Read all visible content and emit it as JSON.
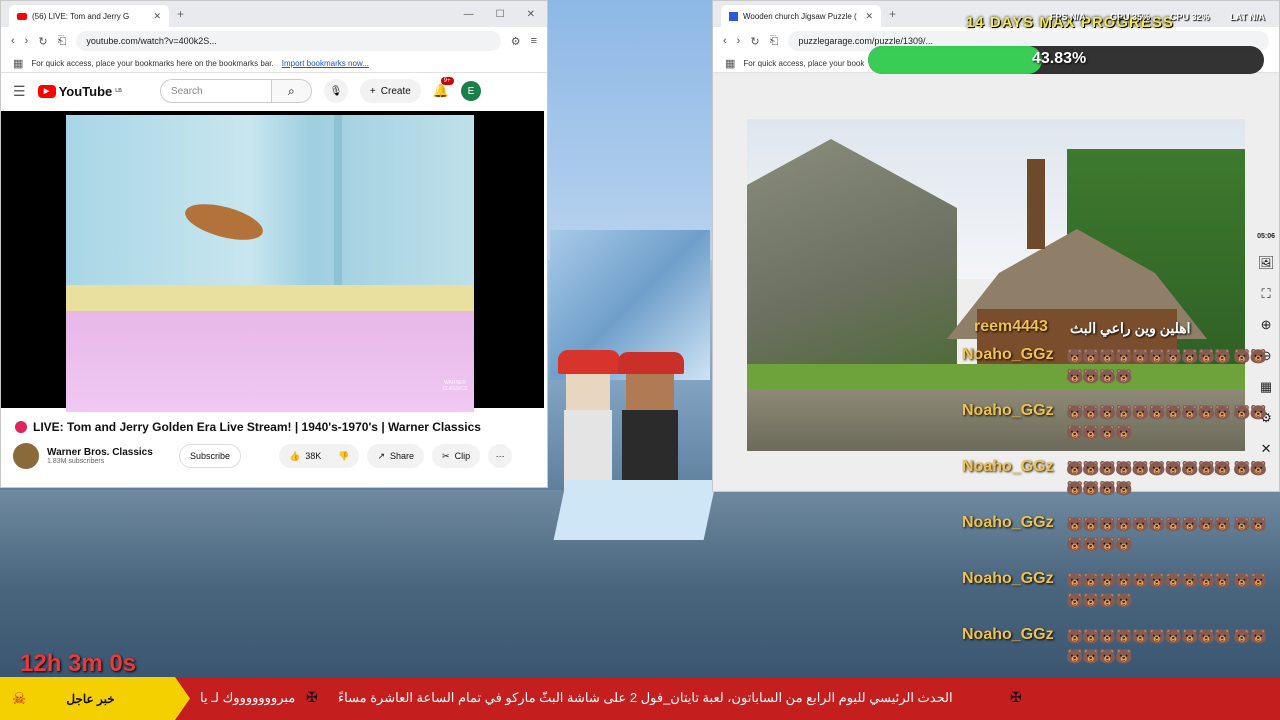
{
  "stream": {
    "timer": "12h 3m 0s",
    "progress_title": "14 DAYS MAX PROGRESS",
    "progress_percent": 43.83,
    "progress_text": "43.83%",
    "progress_color": "#29c948",
    "stats": {
      "fps": "FPS N/A",
      "gpu": "GPU 35%",
      "cpu": "CPU 32%",
      "lat": "LAT N/A"
    },
    "clock": "05:06"
  },
  "yt_window": {
    "tab_title": "(56) LIVE: Tom and Jerry G",
    "url": "youtube.com/watch?v=400k2S...",
    "bookmarks_hint": "For quick access, place your bookmarks here on the bookmarks bar.",
    "import_link": "Import bookmarks now...",
    "logo_text": "YouTube",
    "logo_sup": "LB",
    "search_placeholder": "Search",
    "create_label": "Create",
    "notif_badge": "9+",
    "avatar_letter": "E",
    "video_title": "LIVE: Tom and Jerry Golden Era Live Stream! | 1940's-1970's | Warner Classics",
    "channel_name": "Warner Bros. Classics",
    "channel_subs": "1.83M subscribers",
    "subscribe_label": "Subscribe",
    "like_count": "38K",
    "share_label": "Share",
    "clip_label": "Clip",
    "watermark": "WARNER CLASSICS",
    "accent_color": "#ff0000"
  },
  "pz_window": {
    "tab_title": "Wooden church Jigsaw Puzzle (",
    "url": "puzzlegarage.com/puzzle/1309/...",
    "bookmarks_hint": "For quick access, place your book"
  },
  "chat": [
    {
      "name": "reem4443",
      "msg": "اهلين وين راعي البث"
    },
    {
      "name": "Noaho_GGz",
      "msg": "🐻🐻🐻🐻🐻🐻🐻🐻🐻🐻 🐻🐻🐻🐻🐻🐻"
    },
    {
      "name": "Noaho_GGz",
      "msg": "🐻🐻🐻🐻🐻🐻🐻🐻🐻🐻 🐻🐻🐻🐻🐻🐻"
    },
    {
      "name": "Noaho_GGz",
      "msg": "🐻🐻🐻🐻🐻🐻🐻🐻🐻🐻 🐻🐻🐻🐻🐻🐻"
    },
    {
      "name": "Noaho_GGz",
      "msg": "🐻🐻🐻🐻🐻🐻🐻🐻🐻🐻 🐻🐻🐻🐻🐻🐻"
    },
    {
      "name": "Noaho_GGz",
      "msg": "🐻🐻🐻🐻🐻🐻🐻🐻🐻🐻 🐻🐻🐻🐻🐻🐻"
    },
    {
      "name": "Noaho_GGz",
      "msg": "🐻🐻🐻🐻🐻🐻🐻🐻🐻🐻 🐻🐻🐻🐻🐻🐻"
    }
  ],
  "ticker": {
    "label": "خبر عاجل",
    "text": "الحدث الرئيسي لليوم الرابع من الساباتون، لعبة تايتان_فول 2 على شاشة البثّ ماركو في تمام الساعة العاشرة مساءً",
    "text2": "مبروووووووك لـ يا"
  }
}
